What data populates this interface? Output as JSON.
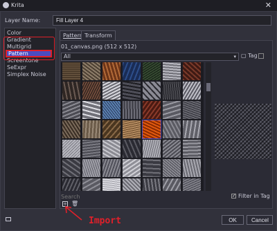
{
  "window": {
    "title": "Krita"
  },
  "layer_name": {
    "label": "Layer Name:",
    "value": "Fill Layer 4"
  },
  "generators": {
    "items": [
      {
        "label": "Color"
      },
      {
        "label": "Gradient"
      },
      {
        "label": "Multigrid"
      },
      {
        "label": "Pattern",
        "selected": true
      },
      {
        "label": "Screentone"
      },
      {
        "label": "SeExpr"
      },
      {
        "label": "Simplex Noise"
      }
    ]
  },
  "tabs": [
    {
      "label": "Pattern",
      "active": true
    },
    {
      "label": "Transform"
    }
  ],
  "pattern": {
    "current_file": "01_canvas.png (512 x 512)",
    "tag_filter": "All",
    "tag_button": "Tag",
    "search_placeholder": "Search",
    "filter_in_tag": "Filter in Tag"
  },
  "annotation": {
    "text": "Import",
    "color": "#e0202a"
  },
  "buttons": {
    "ok": "OK",
    "cancel": "Cancel"
  },
  "icons": {
    "import": "import-icon",
    "delete": "trash-icon",
    "tag": "tag-icon"
  },
  "colors": {
    "accent": "#4c4cc0",
    "highlight": "#e0202a"
  }
}
